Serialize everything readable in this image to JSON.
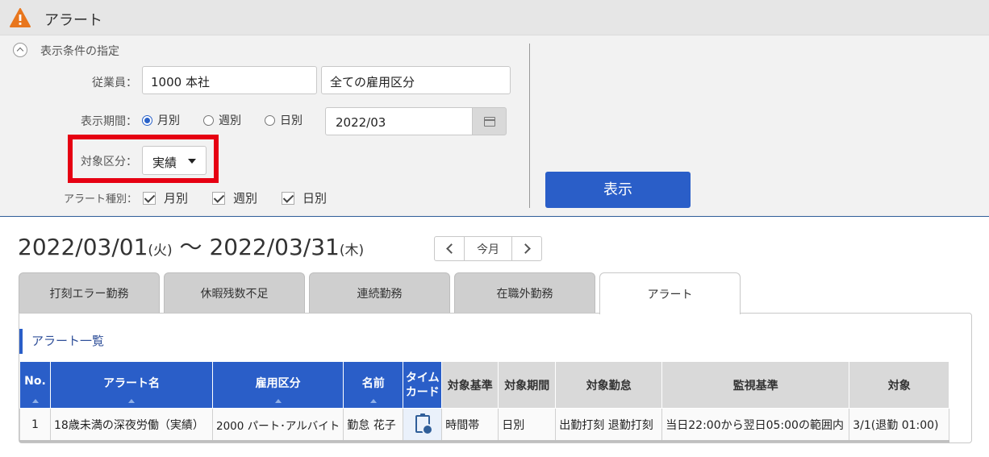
{
  "header": {
    "title": "アラート"
  },
  "conditions": {
    "section_title": "表示条件の指定",
    "employee_label": "従業員：",
    "employee_value": "1000 本社",
    "employment_type_value": "全ての雇用区分",
    "period_label": "表示期間：",
    "period_options": [
      "月別",
      "週別",
      "日別"
    ],
    "period_selected": "月別",
    "date_value": "2022/03",
    "target_label": "対象区分：",
    "target_value": "実績",
    "alert_type_label": "アラート種別：",
    "alert_types": [
      "月別",
      "週別",
      "日別"
    ],
    "show_button": "表示",
    "highlight_color": "#e60012"
  },
  "range": {
    "start": "2022/03/01",
    "start_day": "(火)",
    "sep": " 〜 ",
    "end": "2022/03/31",
    "end_day": "(木)",
    "today_label": "今月"
  },
  "tabs": [
    "打刻エラー勤務",
    "休暇残数不足",
    "連続勤務",
    "在職外勤務",
    "アラート"
  ],
  "active_tab": "アラート",
  "list": {
    "title": "アラート一覧",
    "columns": [
      "No.",
      "アラート名",
      "雇用区分",
      "名前",
      "タイム",
      "カード",
      "対象基準",
      "対象期間",
      "対象勤怠",
      "監視基準",
      "対象"
    ],
    "rows": [
      {
        "no": "1",
        "alert_name": "18歳未満の深夜労働（実績）",
        "employment_type": "2000 パート･アルバイト",
        "name": "勤怠 花子",
        "timecard_icon": "clipboard-clock-icon",
        "basis": "時間帯",
        "period": "日別",
        "attendance": "出勤打刻 退勤打刻",
        "monitor": "当日22:00から翌日05:00の範囲内",
        "target": "3/1(退勤 01:00)"
      }
    ]
  },
  "colors": {
    "accent": "#2a5ec8",
    "header_bg": "#e6e6e6",
    "panel_bg": "#f2f2f2"
  }
}
